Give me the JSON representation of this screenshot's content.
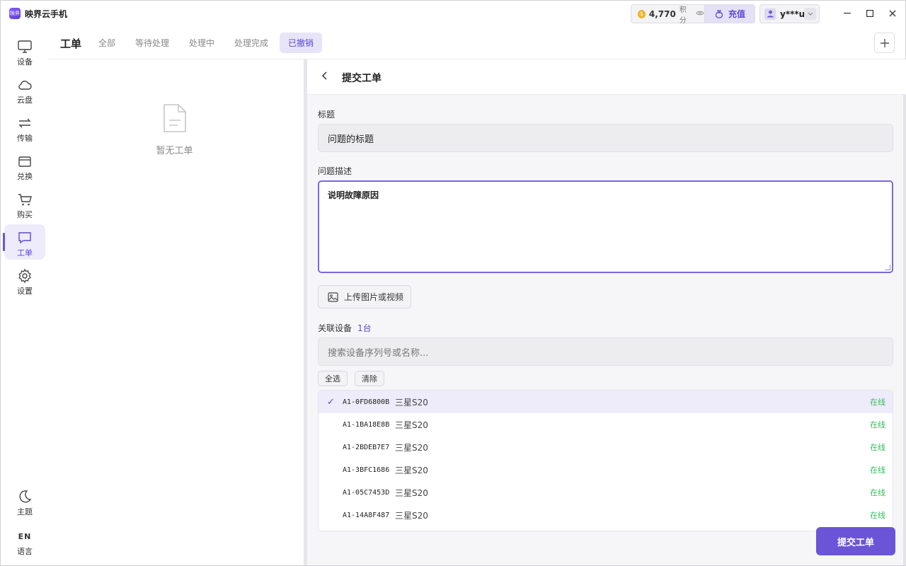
{
  "app": {
    "title": "映界云手机",
    "logo_text": "映界"
  },
  "header": {
    "points_value": "4,770",
    "points_unit": "积分",
    "recharge_label": "充值",
    "user_name": "y***u"
  },
  "sidebar": {
    "items": [
      {
        "label": "设备",
        "icon": "monitor-icon"
      },
      {
        "label": "云盘",
        "icon": "cloud-icon"
      },
      {
        "label": "传输",
        "icon": "transfer-icon"
      },
      {
        "label": "兑换",
        "icon": "ticket-icon"
      },
      {
        "label": "购买",
        "icon": "cart-icon"
      },
      {
        "label": "工单",
        "icon": "message-icon",
        "active": true
      },
      {
        "label": "设置",
        "icon": "gear-icon"
      }
    ],
    "bottom": [
      {
        "label": "主题",
        "icon": "moon-icon"
      },
      {
        "label": "语言",
        "icon_text": "EN"
      }
    ]
  },
  "tabs": {
    "heading": "工单",
    "items": [
      "全部",
      "等待处理",
      "处理中",
      "处理完成",
      "已撤销"
    ],
    "active": "已撤销"
  },
  "list": {
    "empty_text": "暂无工单"
  },
  "detail": {
    "title": "提交工单",
    "title_label": "标题",
    "title_placeholder": "问题的标题",
    "desc_label": "问题描述",
    "desc_value": "说明故障原因",
    "upload_label": "上传图片或视频",
    "device_label": "关联设备",
    "device_count": "1台",
    "search_placeholder": "搜索设备序列号或名称...",
    "select_all": "全选",
    "clear": "清除",
    "devices": [
      {
        "serial": "A1-0FD6800B",
        "model": "三星S20",
        "status": "在线",
        "selected": true
      },
      {
        "serial": "A1-1BA18E8B",
        "model": "三星S20",
        "status": "在线",
        "selected": false
      },
      {
        "serial": "A1-2BDEB7E7",
        "model": "三星S20",
        "status": "在线",
        "selected": false
      },
      {
        "serial": "A1-3BFC1686",
        "model": "三星S20",
        "status": "在线",
        "selected": false
      },
      {
        "serial": "A1-05C7453D",
        "model": "三星S20",
        "status": "在线",
        "selected": false
      },
      {
        "serial": "A1-14A8F487",
        "model": "三星S20",
        "status": "在线",
        "selected": false
      }
    ],
    "submit_label": "提交工单"
  },
  "colors": {
    "accent": "#6b55d6",
    "online": "#2fbf5a",
    "coin": "#f0b429"
  }
}
